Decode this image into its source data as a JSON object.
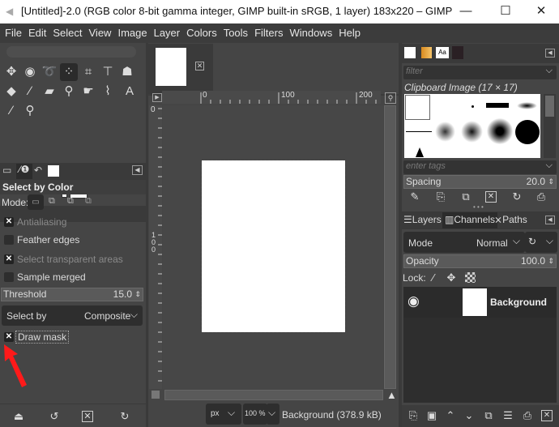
{
  "window": {
    "title": "[Untitled]-2.0 (RGB color 8-bit gamma integer, GIMP built-in sRGB, 1 layer) 183x220 – GIMP",
    "minimize": "—",
    "maximize": "☐",
    "close": "✕"
  },
  "menu": [
    "File",
    "Edit",
    "Select",
    "View",
    "Image",
    "Layer",
    "Colors",
    "Tools",
    "Filters",
    "Windows",
    "Help"
  ],
  "toolbox": {
    "tools": [
      {
        "name": "move-tool-icon",
        "glyph": "✥"
      },
      {
        "name": "ellipse-select-icon",
        "glyph": "◉"
      },
      {
        "name": "free-select-icon",
        "glyph": "➰"
      },
      {
        "name": "select-by-color-icon",
        "glyph": "⁘"
      },
      {
        "name": "crop-icon",
        "glyph": "⌗"
      },
      {
        "name": "unified-transform-icon",
        "glyph": "⊤"
      },
      {
        "name": "warp-transform-icon",
        "glyph": "☗"
      },
      {
        "name": "bucket-fill-icon",
        "glyph": "◆"
      },
      {
        "name": "paintbrush-icon",
        "glyph": "∕"
      },
      {
        "name": "eraser-icon",
        "glyph": "▰"
      },
      {
        "name": "clone-icon",
        "glyph": "⚲"
      },
      {
        "name": "smudge-icon",
        "glyph": "☛"
      },
      {
        "name": "paths-icon",
        "glyph": "⌇"
      },
      {
        "name": "text-icon",
        "glyph": "A"
      },
      {
        "name": "color-picker-icon",
        "glyph": "∕"
      },
      {
        "name": "zoom-icon",
        "glyph": "⚲"
      }
    ],
    "swap_glyph": "⮌"
  },
  "tool_options": {
    "title": "Select by Color",
    "mode_label": "Mode:",
    "antialiasing": {
      "label": "Antialiasing",
      "checked": true
    },
    "feather_edges": {
      "label": "Feather edges",
      "checked": false
    },
    "select_transparent": {
      "label": "Select transparent areas",
      "checked": true
    },
    "sample_merged": {
      "label": "Sample merged",
      "checked": false
    },
    "threshold": {
      "label": "Threshold",
      "value": "15.0"
    },
    "select_by": {
      "label": "Select by",
      "value": "Composite"
    },
    "draw_mask": {
      "label": "Draw mask",
      "checked": true
    },
    "bottom_buttons": [
      "save-options-icon",
      "restore-options-icon",
      "delete-options-icon",
      "reset-options-icon"
    ]
  },
  "canvas": {
    "ruler_labels": [
      "0",
      "100",
      "200"
    ],
    "vruler_labels": [
      "0",
      "1",
      "0",
      "0"
    ],
    "unit": "px",
    "zoom": "100 %",
    "status": "Background (378.9 kB)",
    "image_size": "183x220"
  },
  "brushes": {
    "filter_placeholder": "filter",
    "brush_name": "Clipboard Image (17 × 17)",
    "tags_placeholder": "enter tags",
    "spacing": {
      "label": "Spacing",
      "value": "20.0"
    }
  },
  "layers": {
    "tabs": [
      "Layers",
      "Channels",
      "Paths"
    ],
    "mode": {
      "label": "Mode",
      "value": "Normal"
    },
    "opacity": {
      "label": "Opacity",
      "value": "100.0"
    },
    "lock_label": "Lock:",
    "items": [
      {
        "name": "Background",
        "visible": true
      }
    ]
  },
  "colors": {
    "annotation_arrow": "#ff1a1a"
  }
}
